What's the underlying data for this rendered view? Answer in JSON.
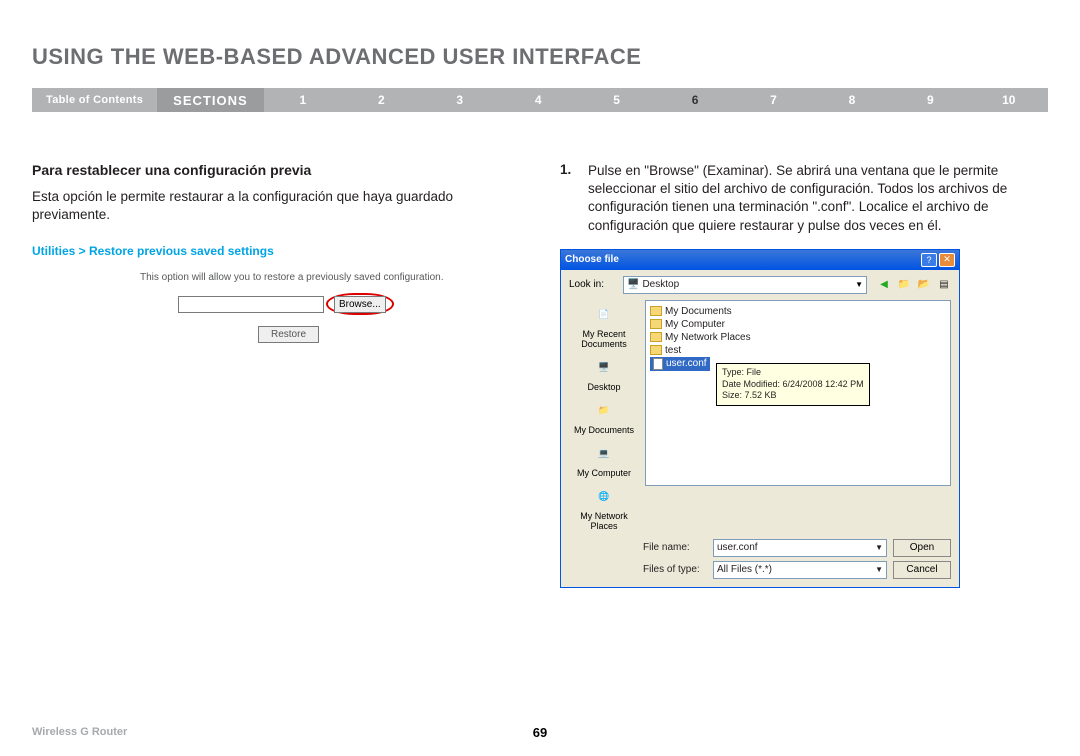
{
  "title": "USING THE WEB-BASED ADVANCED USER INTERFACE",
  "nav": {
    "toc": "Table of Contents",
    "sections": "SECTIONS",
    "nums": [
      "1",
      "2",
      "3",
      "4",
      "5",
      "6",
      "7",
      "8",
      "9",
      "10"
    ],
    "active": "6"
  },
  "left": {
    "subhead": "Para restablecer una configuración previa",
    "para": "Esta opción le permite restaurar a la configuración que haya guardado previamente.",
    "breadcrumb": "Utilities > Restore previous saved settings",
    "caption": "This option will allow you to restore a previously saved configuration.",
    "browse": "Browse...",
    "restore": "Restore"
  },
  "right": {
    "num": "1.",
    "text": "Pulse en \"Browse\" (Examinar). Se abrirá una ventana que le permite seleccionar el sitio del archivo de configuración. Todos los archivos de configuración tienen una terminación \".conf\". Localice el archivo de configuración que quiere restaurar y pulse dos veces en él."
  },
  "dialog": {
    "title": "Choose file",
    "lookin_label": "Look in:",
    "lookin_value": "Desktop",
    "sidebar": [
      "My Recent Documents",
      "Desktop",
      "My Documents",
      "My Computer",
      "My Network Places"
    ],
    "files": [
      {
        "name": "My Documents",
        "type": "folder"
      },
      {
        "name": "My Computer",
        "type": "folder"
      },
      {
        "name": "My Network Places",
        "type": "folder"
      },
      {
        "name": "test",
        "type": "folder"
      },
      {
        "name": "user.conf",
        "type": "file",
        "selected": true
      }
    ],
    "tooltip": {
      "l1": "Type: File",
      "l2": "Date Modified: 6/24/2008 12:42 PM",
      "l3": "Size: 7.52 KB"
    },
    "filename_label": "File name:",
    "filename_value": "user.conf",
    "filetype_label": "Files of type:",
    "filetype_value": "All Files (*.*)",
    "open": "Open",
    "cancel": "Cancel"
  },
  "footer": {
    "product": "Wireless G Router",
    "page": "69"
  }
}
